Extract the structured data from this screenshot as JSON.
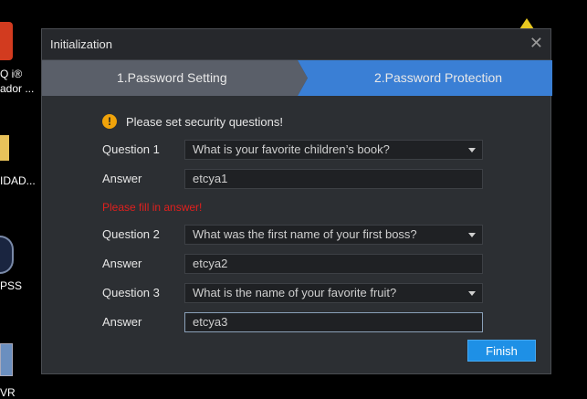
{
  "desktop": {
    "icons": [
      {
        "label": "Q i®"
      },
      {
        "label": "ador ..."
      },
      {
        "label": "IDAD..."
      },
      {
        "label": "PSS"
      },
      {
        "label": "VR"
      }
    ]
  },
  "dialog": {
    "title": "Initialization",
    "close_symbol": "✕",
    "steps": [
      {
        "label": "1.Password Setting",
        "active": false
      },
      {
        "label": "2.Password Protection",
        "active": true
      }
    ],
    "prompt": "Please set security questions!",
    "questions": [
      {
        "label": "Question 1",
        "value": "What is your favorite children’s book?",
        "answer_label": "Answer",
        "answer": "etcya1"
      },
      {
        "label": "Question 2",
        "value": "What was the first name of your first boss?",
        "answer_label": "Answer",
        "answer": "etcya2"
      },
      {
        "label": "Question 3",
        "value": "What is the name of your favorite fruit?",
        "answer_label": "Answer",
        "answer": "etcya3"
      }
    ],
    "error": "Please fill in answer!",
    "finish_label": "Finish"
  },
  "colors": {
    "active_step": "#3a7fd5",
    "inactive_step": "#5a5f69",
    "error": "#e0201e",
    "warning": "#f0a30a",
    "button": "#1e90e6"
  }
}
